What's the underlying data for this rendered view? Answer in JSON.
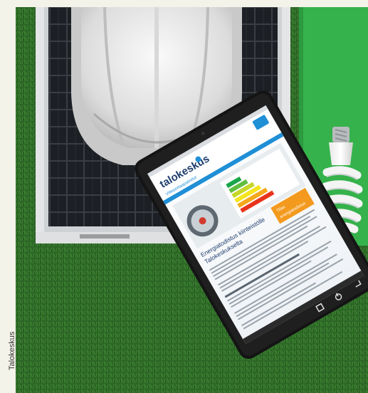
{
  "credit": "Talokeskus",
  "tablet": {
    "brand": "talokeskus",
    "subtitle": "Viiteportaapalvelut",
    "heading_line1": "Energiatodistus kiinteistölle",
    "heading_line2": "Talokeskukselta",
    "badge_line1": "Tilaa",
    "badge_line2": "energiatodistus"
  },
  "colors": {
    "grass": "#2f6a28",
    "green_panel": "#38b850",
    "tablet_accent": "#1f8fd6",
    "badge": "#f39a1e"
  }
}
